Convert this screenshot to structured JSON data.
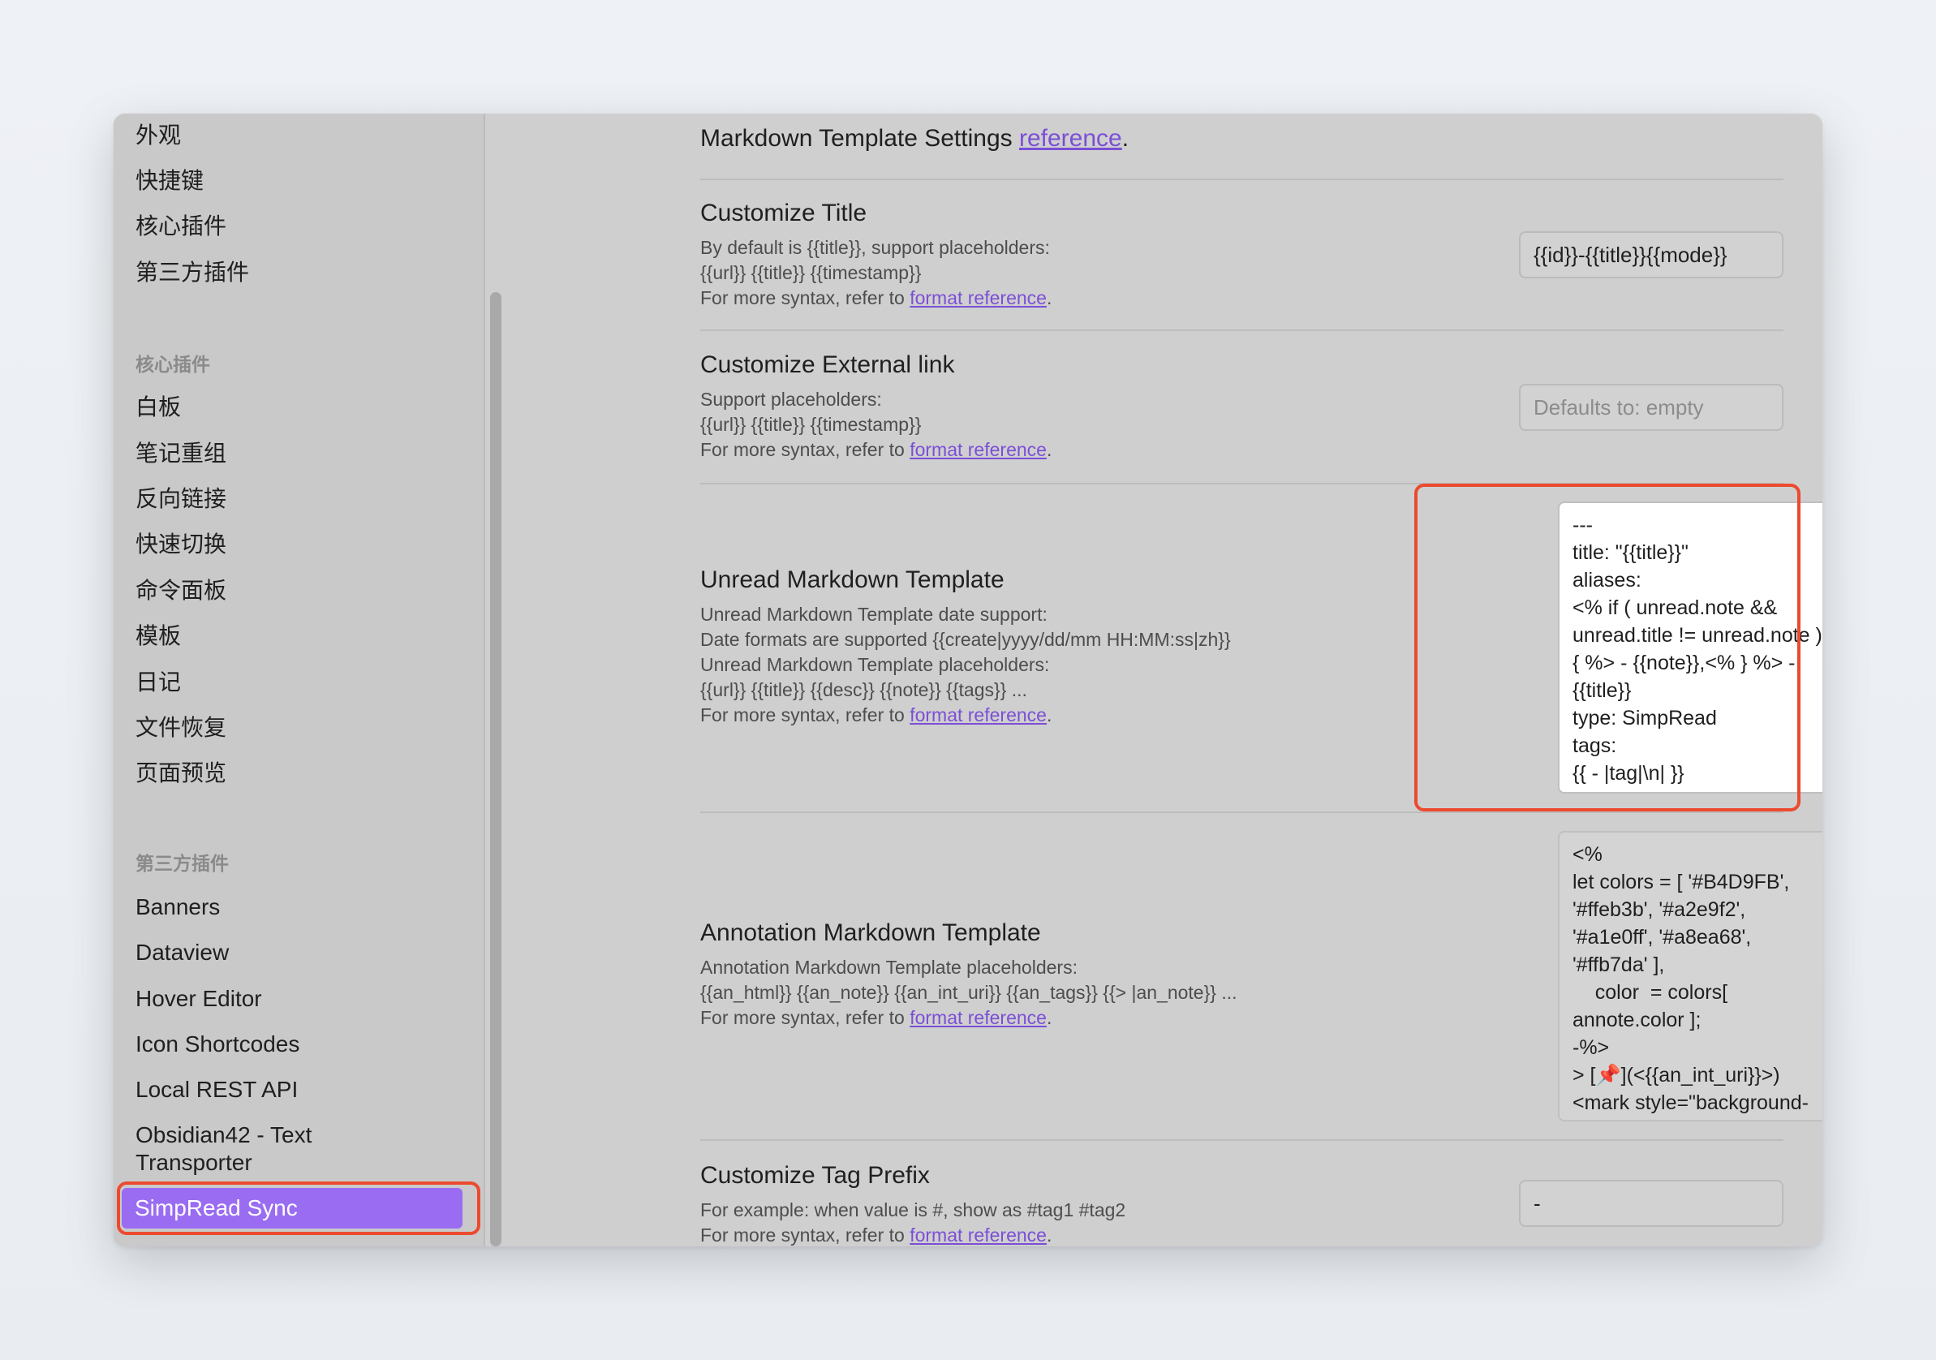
{
  "sidebar": {
    "top_items": [
      "外观",
      "快捷键",
      "核心插件",
      "第三方插件"
    ],
    "core_heading": "核心插件",
    "core_items": [
      "白板",
      "笔记重组",
      "反向链接",
      "快速切换",
      "命令面板",
      "模板",
      "日记",
      "文件恢复",
      "页面预览"
    ],
    "third_heading": "第三方插件",
    "third_items": [
      "Banners",
      "Dataview",
      "Hover Editor",
      "Icon Shortcodes",
      "Local REST API",
      "Obsidian42 - Text",
      "Transporter"
    ],
    "active_item": "SimpRead Sync"
  },
  "main": {
    "heading_text": "Markdown Template Settings ",
    "heading_link": "reference",
    "heading_end": ".",
    "more_syntax": "For more syntax, refer to ",
    "format_link": "format reference",
    "period": ".",
    "title_setting": {
      "title": "Customize Title",
      "line1": "By default is {{title}}, support placeholders:",
      "line2": "{{url}} {{title}} {{timestamp}}",
      "value": "{{id}}-{{title}}{{mode}}"
    },
    "external_link": {
      "title": "Customize External link",
      "line1": "Support placeholders:",
      "line2": "{{url}} {{title}} {{timestamp}}",
      "placeholder": "Defaults to: empty"
    },
    "unread_template": {
      "title": "Unread Markdown Template",
      "line1": "Unread Markdown Template date support:",
      "line2": "Date formats are supported {{create|yyyy/dd/mm HH:MM:ss|zh}}",
      "line3": "Unread Markdown Template placeholders:",
      "line4": "{{url}} {{title}} {{desc}} {{note}} {{tags}} ...",
      "code": [
        "---",
        "title: \"{{title}}\"",
        "aliases:",
        "<% if ( unread.note &&",
        "unread.title != unread.note )",
        "{ %> - {{note}},<% } %> -",
        "{{title}}",
        "type: SimpRead",
        "tags:",
        "{{ - |tag|\\n| }}"
      ]
    },
    "annotation_template": {
      "title": "Annotation Markdown Template",
      "line1": "Annotation Markdown Template placeholders:",
      "line2": "{{an_html}} {{an_note}} {{an_int_uri}} {{an_tags}} {{> |an_note}} ...",
      "code": [
        "<%",
        "let colors = [ '#B4D9FB',",
        "'#ffeb3b', '#a2e9f2',",
        "'#a1e0ff', '#a8ea68',",
        "'#ffb7da' ],",
        "    color  = colors[",
        "annote.color ];",
        "-%>"
      ],
      "code_pin_prefix": "> [",
      "code_pin": "📌",
      "code_pin_suffix": "](<{{an_int_uri}}>)",
      "code_last": "<mark style=\"background-"
    },
    "tag_prefix": {
      "title": "Customize Tag Prefix",
      "line1": "For example: when value is #, show as #tag1 #tag2",
      "value": "-"
    }
  }
}
